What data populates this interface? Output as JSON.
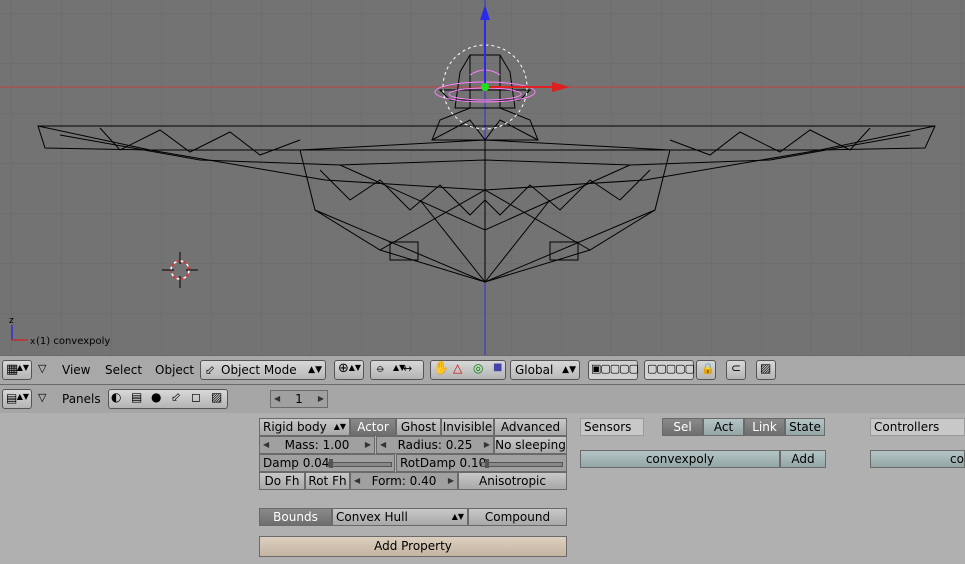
{
  "viewport": {
    "object_label": "(1) convexpoly",
    "axis_z": "z",
    "axis_x": "x"
  },
  "header3d": {
    "menus": [
      "View",
      "Select",
      "Object"
    ],
    "mode": "Object Mode",
    "orientation": "Global"
  },
  "buttons_header": {
    "panels": "Panels",
    "frame": "1"
  },
  "physics": {
    "type": "Rigid body",
    "actor": "Actor",
    "ghost": "Ghost",
    "invisible": "Invisible",
    "advanced": "Advanced",
    "mass": "Mass: 1.00",
    "radius": "Radius: 0.25",
    "no_sleeping": "No sleeping",
    "damp": "Damp 0.04",
    "rotdamp": "RotDamp 0.10",
    "do_fh": "Do Fh",
    "rot_fh": "Rot Fh",
    "form": "Form: 0.40",
    "anisotropic": "Anisotropic",
    "bounds": "Bounds",
    "bounds_type": "Convex Hull",
    "compound": "Compound",
    "add_property": "Add Property"
  },
  "sensors": {
    "title": "Sensors",
    "sel": "Sel",
    "act": "Act",
    "link": "Link",
    "state": "State",
    "object": "convexpoly",
    "add": "Add"
  },
  "controllers": {
    "title": "Controllers",
    "object_partial": "co"
  },
  "colors": {
    "viewport_bg": "#737373",
    "grid": "#6a6a6a",
    "x_axis": "#c83030",
    "y_axis": "#2020d0",
    "selection": "#ff80ff"
  }
}
